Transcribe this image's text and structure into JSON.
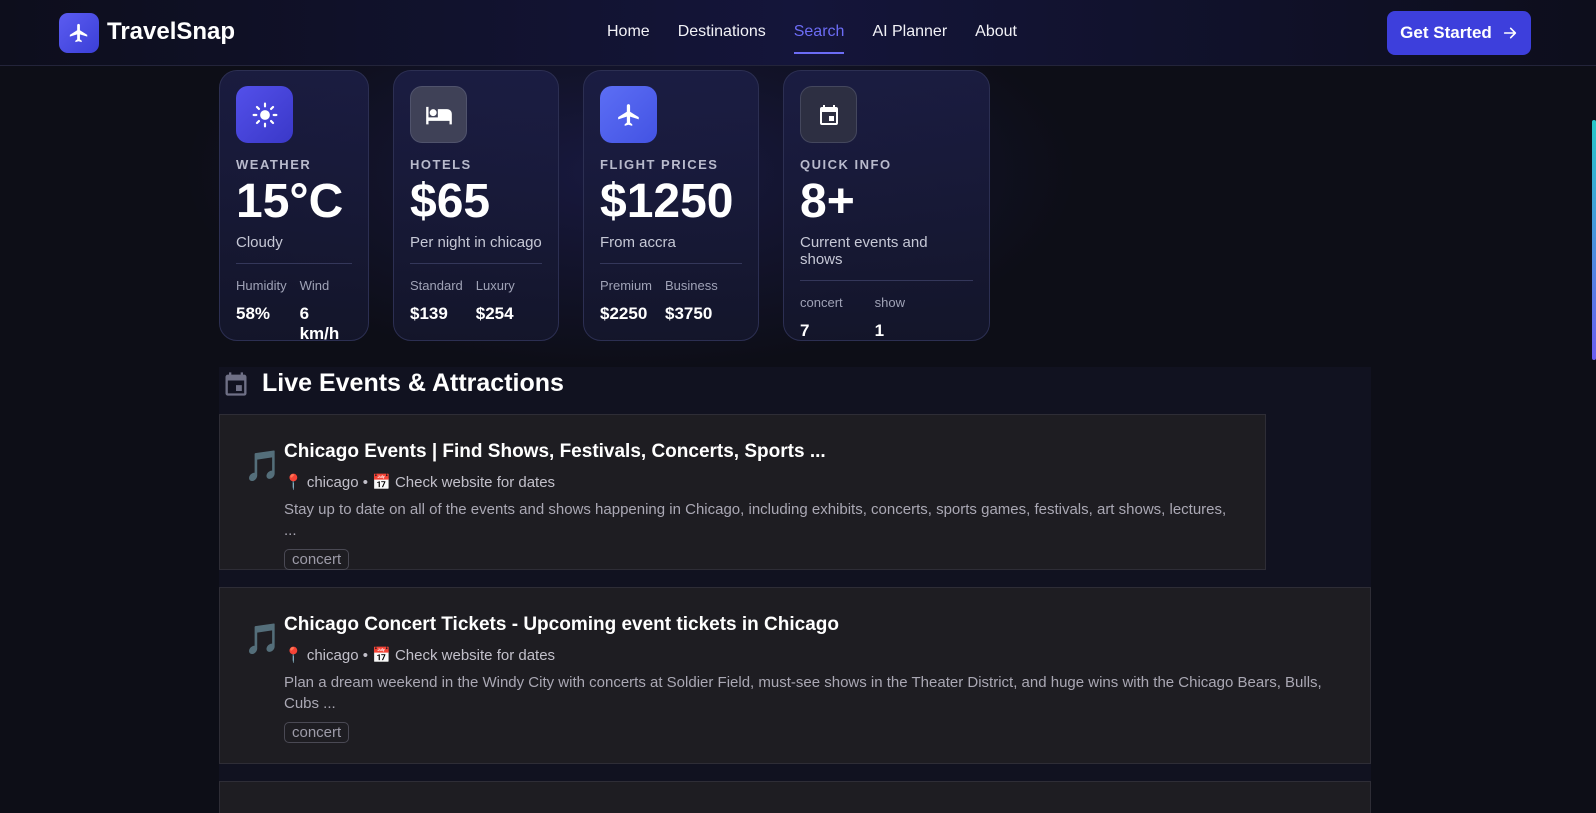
{
  "nav": {
    "logo_text": "TravelSnap",
    "links": [
      {
        "label": "Home"
      },
      {
        "label": "Destinations"
      },
      {
        "label": "Search"
      },
      {
        "label": "AI Planner"
      },
      {
        "label": "About"
      }
    ],
    "active_link": "Search",
    "cta_label": "Get Started"
  },
  "cards": {
    "weather": {
      "icon": "sun-icon",
      "label": "WEATHER",
      "value": "15°C",
      "sub": "Cloudy",
      "stats": [
        {
          "key": "Humidity",
          "value": "58%"
        },
        {
          "key": "Wind",
          "value": "6 km/h"
        }
      ]
    },
    "hotels": {
      "icon": "bed-icon",
      "label": "HOTELS",
      "value": "$65",
      "sub": "Per night in chicago",
      "stats": [
        {
          "key": "Standard",
          "value": "$139"
        },
        {
          "key": "Luxury",
          "value": "$254"
        }
      ]
    },
    "flights": {
      "icon": "airplane-icon",
      "label": "FLIGHT PRICES",
      "value": "$1250",
      "sub": "From accra",
      "stats": [
        {
          "key": "Premium",
          "value": "$2250"
        },
        {
          "key": "Business",
          "value": "$3750"
        }
      ]
    },
    "quick": {
      "icon": "calendar-icon",
      "label": "QUICK INFO",
      "value": "8+",
      "sub": "Current events and shows",
      "stats": [
        {
          "key": "concert",
          "value": "7"
        },
        {
          "key": "show",
          "value": "1"
        }
      ]
    }
  },
  "events": {
    "section_title": "Live Events & Attractions",
    "items": [
      {
        "emoji": "🎵",
        "title": "Chicago Events | Find Shows, Festivals, Concerts, Sports ...",
        "meta": "📍 chicago • 📅 Check website for dates",
        "description": "Stay up to date on all of the events and shows happening in Chicago, including exhibits, concerts, sports games, festivals, art shows, lectures, ...",
        "tag": "concert"
      },
      {
        "emoji": "🎵",
        "title": "Chicago Concert Tickets - Upcoming event tickets in Chicago",
        "meta": "📍 chicago • 📅 Check website for dates",
        "description": "Plan a dream weekend in the Windy City with concerts at Soldier Field, must-see shows in the Theater District, and huge wins with the Chicago Bears, Bulls, Cubs ...",
        "tag": "concert"
      },
      {
        "emoji": "",
        "title": "",
        "meta": "",
        "description": "",
        "tag": ""
      }
    ]
  }
}
